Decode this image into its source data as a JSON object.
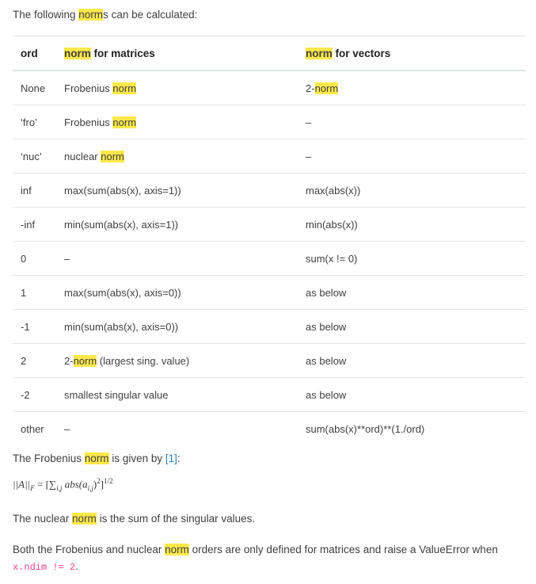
{
  "intro": {
    "before": "The following ",
    "highlight": "norm",
    "after": "s can be calculated:"
  },
  "table": {
    "headers": {
      "ord": "ord",
      "matrices": {
        "highlight": "norm",
        "rest": " for matrices"
      },
      "vectors": {
        "highlight": "norm",
        "rest": " for vectors"
      }
    },
    "rows": [
      {
        "ord": "None",
        "matrices": {
          "before": "Frobenius ",
          "highlight": "norm",
          "after": ""
        },
        "vectors": {
          "before": "2-",
          "highlight": "norm",
          "after": ""
        }
      },
      {
        "ord": "‘fro’",
        "matrices": {
          "before": "Frobenius ",
          "highlight": "norm",
          "after": ""
        },
        "vectors": {
          "before": "–",
          "highlight": "",
          "after": ""
        }
      },
      {
        "ord": "‘nuc’",
        "matrices": {
          "before": "nuclear ",
          "highlight": "norm",
          "after": ""
        },
        "vectors": {
          "before": "–",
          "highlight": "",
          "after": ""
        }
      },
      {
        "ord": "inf",
        "matrices": {
          "before": "max(sum(abs(x), axis=1))",
          "highlight": "",
          "after": ""
        },
        "vectors": {
          "before": "max(abs(x))",
          "highlight": "",
          "after": ""
        }
      },
      {
        "ord": "-inf",
        "matrices": {
          "before": "min(sum(abs(x), axis=1))",
          "highlight": "",
          "after": ""
        },
        "vectors": {
          "before": "min(abs(x))",
          "highlight": "",
          "after": ""
        }
      },
      {
        "ord": "0",
        "matrices": {
          "before": "–",
          "highlight": "",
          "after": ""
        },
        "vectors": {
          "before": "sum(x != 0)",
          "highlight": "",
          "after": ""
        }
      },
      {
        "ord": "1",
        "matrices": {
          "before": "max(sum(abs(x), axis=0))",
          "highlight": "",
          "after": ""
        },
        "vectors": {
          "before": "as below",
          "highlight": "",
          "after": ""
        }
      },
      {
        "ord": "-1",
        "matrices": {
          "before": "min(sum(abs(x), axis=0))",
          "highlight": "",
          "after": ""
        },
        "vectors": {
          "before": "as below",
          "highlight": "",
          "after": ""
        }
      },
      {
        "ord": "2",
        "matrices": {
          "before": "2-",
          "highlight": "norm",
          "after": " (largest sing. value)"
        },
        "vectors": {
          "before": "as below",
          "highlight": "",
          "after": ""
        }
      },
      {
        "ord": "-2",
        "matrices": {
          "before": "smallest singular value",
          "highlight": "",
          "after": ""
        },
        "vectors": {
          "before": "as below",
          "highlight": "",
          "after": ""
        }
      },
      {
        "ord": "other",
        "matrices": {
          "before": "–",
          "highlight": "",
          "after": ""
        },
        "vectors": {
          "before": "sum(abs(x)**ord)**(1./ord)",
          "highlight": "",
          "after": ""
        }
      }
    ]
  },
  "frobenius": {
    "before": "The Frobenius ",
    "highlight": "norm",
    "middle": " is given by ",
    "ref": "[1]",
    "after": ":"
  },
  "formula": {
    "lhs": "||A||",
    "lhs_sub": "F",
    "eq": " = [",
    "sum": "∑",
    "sum_sub": "i,j",
    "body": " abs(a",
    "body_sub": "i,j",
    "close": ")",
    "sq": "2",
    "bracket": "]",
    "exp": "1/2"
  },
  "nuclear": {
    "before": "The nuclear ",
    "highlight": "norm",
    "after": " is the sum of the singular values."
  },
  "both": {
    "before": "Both the Frobenius and nuclear ",
    "highlight": "norm",
    "after": " orders are only defined for matrices and raise a ValueError when ",
    "code": "x.ndim != 2",
    "end": "."
  }
}
